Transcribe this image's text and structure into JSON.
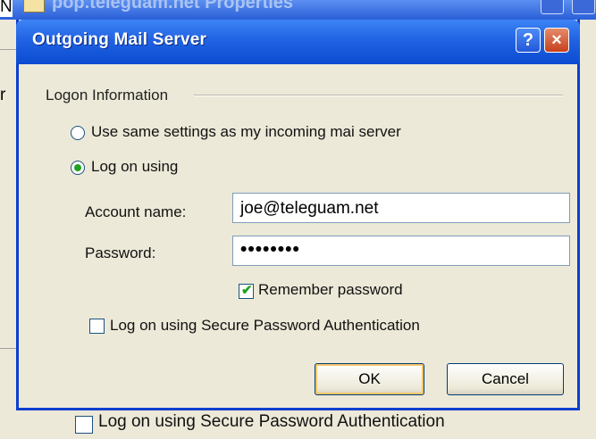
{
  "background_window": {
    "title": "pop.teleguam.net Properties",
    "left_label": "N",
    "left_item": "r",
    "checkbox_label": "Log on using Secure Password Authentication"
  },
  "dialog": {
    "title": "Outgoing Mail Server",
    "help_label": "?",
    "close_label": "×",
    "group_label": "Logon Information",
    "option_same": "Use same settings as my incoming mai server",
    "option_logon": "Log on using",
    "account_label": "Account name:",
    "account_value": "joe@teleguam.net",
    "password_label": "Password:",
    "password_value": "••••••••",
    "remember_label": "Remember password",
    "spa_label": "Log on using Secure Password Authentication",
    "ok_label": "OK",
    "cancel_label": "Cancel"
  },
  "state": {
    "selected_option": "option_logon",
    "remember_checked": true,
    "spa_checked": false
  },
  "colors": {
    "titlebar": "#2163e3",
    "dialog_face": "#ece9d8",
    "radio_dot": "#21a121",
    "close_button": "#c8401c"
  }
}
